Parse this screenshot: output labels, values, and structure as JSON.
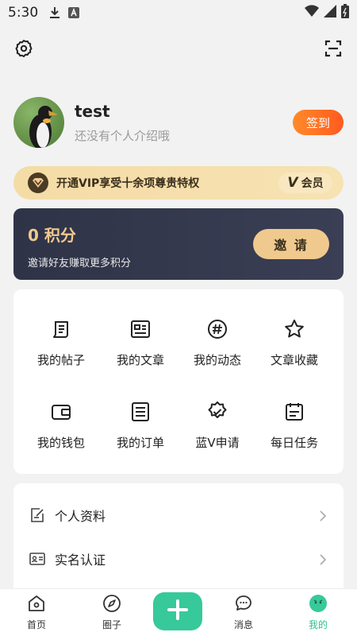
{
  "status_bar": {
    "time": "5:30",
    "icons": [
      "download-icon",
      "a-box-icon",
      "wifi-icon",
      "signal-icon",
      "battery-icon"
    ]
  },
  "top_bar": {
    "left_icon": "gear-icon",
    "right_icon": "scan-icon"
  },
  "profile": {
    "username": "test",
    "bio": "还没有个人介绍哦",
    "signin_label": "签到"
  },
  "vip": {
    "text": "开通VIP享受十余项尊贵特权",
    "badge_v": "V",
    "badge_label": "会员"
  },
  "points": {
    "value": "0 积分",
    "desc": "邀请好友赚取更多积分",
    "invite_label": "邀 请"
  },
  "grid": {
    "items": [
      {
        "label": "我的帖子",
        "icon": "post-icon"
      },
      {
        "label": "我的文章",
        "icon": "article-icon"
      },
      {
        "label": "我的动态",
        "icon": "hashtag-icon"
      },
      {
        "label": "文章收藏",
        "icon": "star-icon"
      },
      {
        "label": "我的钱包",
        "icon": "wallet-icon"
      },
      {
        "label": "我的订单",
        "icon": "order-icon"
      },
      {
        "label": "蓝V申请",
        "icon": "verified-badge-icon"
      },
      {
        "label": "每日任务",
        "icon": "calendar-task-icon"
      }
    ]
  },
  "menu": {
    "items": [
      {
        "label": "个人资料",
        "icon": "edit-profile-icon"
      },
      {
        "label": "实名认证",
        "icon": "id-card-icon"
      }
    ]
  },
  "tabbar": {
    "items": [
      {
        "label": "首页",
        "icon": "home-icon"
      },
      {
        "label": "圈子",
        "icon": "compass-icon"
      },
      {
        "label": "消息",
        "icon": "chat-icon"
      },
      {
        "label": "我的",
        "icon": "me-icon"
      }
    ],
    "active": "我的"
  },
  "colors": {
    "accent_green": "#37c99a",
    "signin_orange": "#ff6a22",
    "gold": "#f0c98e",
    "dark_card": "#343849"
  }
}
